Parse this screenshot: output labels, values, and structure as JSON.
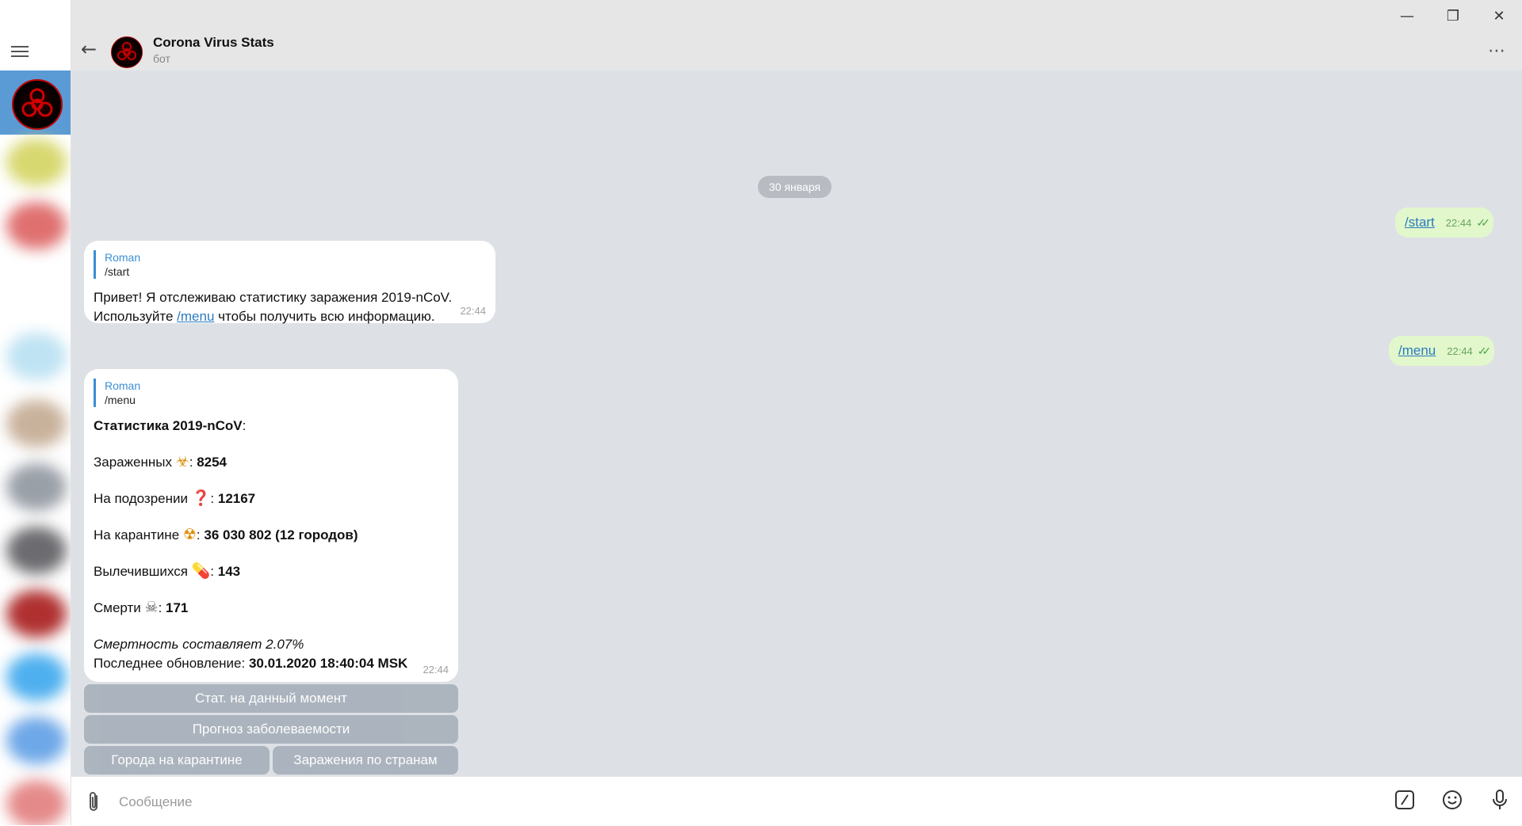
{
  "header": {
    "title": "Corona Virus Stats",
    "subtitle": "бот"
  },
  "chat": {
    "date_separator": "30 января",
    "outgoing": [
      {
        "text": "/start",
        "time": "22:44"
      },
      {
        "text": "/menu",
        "time": "22:44"
      }
    ],
    "msg1": {
      "reply_name": "Roman",
      "reply_text": "/start",
      "line1": "Привет! Я отслеживаю статистику заражения 2019-nCoV.",
      "line2_prefix": "Используйте ",
      "line2_link": "/menu",
      "line2_suffix": " чтобы получить всю информацию.",
      "time": "22:44"
    },
    "msg2": {
      "reply_name": "Roman",
      "reply_text": "/menu",
      "heading": "Статистика 2019-nCoV",
      "heading_suffix": ":",
      "infected_label": "Зараженных ",
      "infected_emoji": "☣",
      "infected_sep": ": ",
      "infected_value": "8254",
      "suspected_label": "На подозрении ",
      "suspected_emoji": "❓",
      "suspected_sep": ": ",
      "suspected_value": "12167",
      "quarantine_label": "На карантине ",
      "quarantine_emoji": "☢",
      "quarantine_sep": ": ",
      "quarantine_value": "36 030 802 (12 городов)",
      "recovered_label": "Вылечившихся ",
      "recovered_emoji": "💊",
      "recovered_sep": ": ",
      "recovered_value": "143",
      "deaths_label": "Смерти ",
      "deaths_emoji": "☠",
      "deaths_sep": ": ",
      "deaths_value": "171",
      "mortality": "Смертность составляет 2.07%",
      "updated_label": "Последнее обновление: ",
      "updated_value": "30.01.2020 18:40:04 MSK",
      "time": "22:44"
    },
    "keyboard": {
      "btn_now": "Стат. на данный момент",
      "btn_forecast": "Прогноз заболеваемости",
      "btn_cities": "Города на карантине",
      "btn_countries": "Заражения по странам"
    }
  },
  "input": {
    "placeholder": "Сообщение"
  },
  "colors": {
    "accent": "#3b8fd3",
    "outgoing_bubble": "#e2f7cb",
    "chat_bg": "#dde1e6"
  }
}
